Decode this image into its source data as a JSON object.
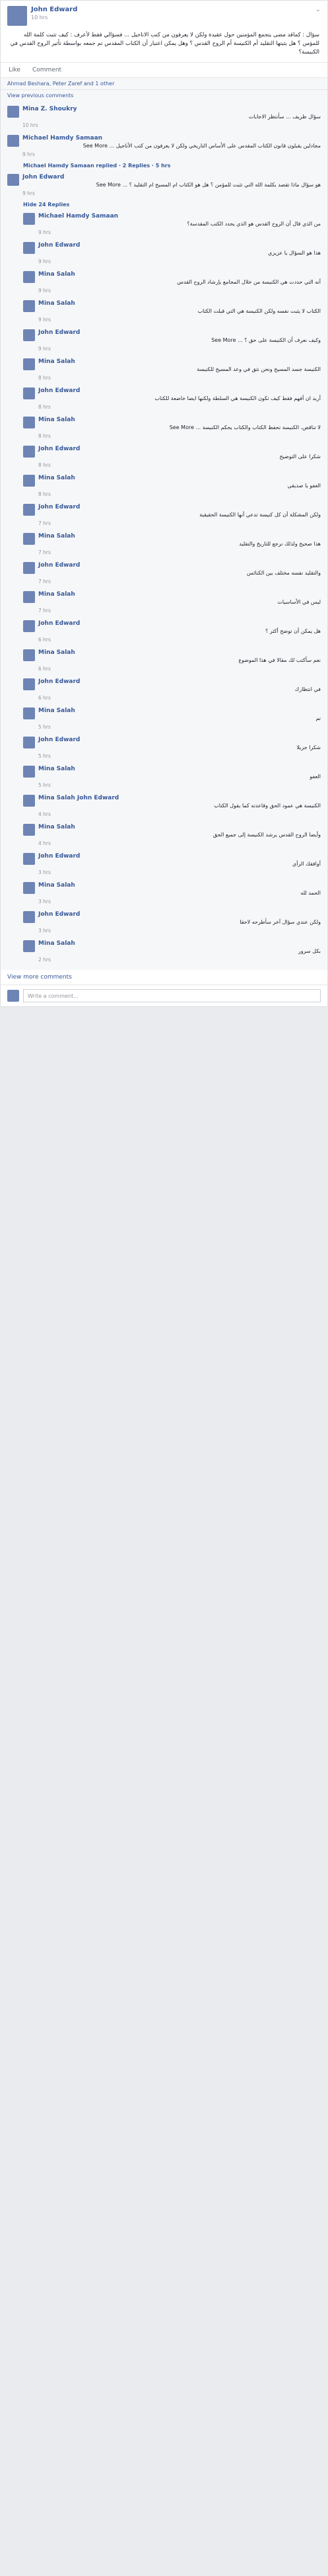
{
  "post": {
    "author": "John Edward",
    "time": "10 hrs",
    "text": "سؤال : كماقد مضى يتجمع المؤمنين حول عقيدة ولكن لا يعرفون من كتب الاناجيل ... فسؤالي فقط لأعرف : كيف تثبت كلمة الله للمؤمن ؟ هل يثبتها التقليد أم الكنيسة أم الروح القدس ؟ وهل يمكن اعتبار أن الكتاب المقدس تم جمعه بواسطة تأثير الروح القدس في الكنيسة؟",
    "actions": {
      "like": "Like",
      "comment": "Comment"
    },
    "likes": "Ahmad Beshara, Peter Zaref and 1 other",
    "view_previous": "View previous comments"
  },
  "comments": [
    {
      "name": "Mina Z. Shoukry",
      "text": "سؤال ظريف ... سأنتظر الاجابات",
      "time": "10 hrs",
      "reply": false
    },
    {
      "name": "Michael Hamdy Samaan",
      "text": "مجادلين يقبلون قانون الكتاب المقدس على الأساس التاريخي ولكن لا يعرفون من كتب الأناجيل ... See More",
      "time": "9 hrs",
      "reply": false
    },
    {
      "name": "Michael Hamdy Samaan replied · 2 Replies · 5 hrs",
      "text": "",
      "time": "",
      "reply": true,
      "toggle": true
    },
    {
      "name": "John Edward",
      "text": "هو سؤال ماذا تقصد بكلمة الله التي تثبت للمؤمن ؟ هل هو الكتاب ام المسيح ام التقليد ؟ ... See More",
      "time": "9 hrs",
      "reply": false
    },
    {
      "name": "Hide 24 Replies",
      "text": "",
      "time": "",
      "reply": true,
      "toggle": true
    },
    {
      "name": "Michael Hamdy Samaan",
      "text": "من الذي قال أن الروح القدس هو الذي يحدد الكتب المقدسة؟",
      "time": "9 hrs",
      "reply": true
    },
    {
      "name": "John Edward",
      "text": "هذا هو السؤال يا عزيزي",
      "time": "9 hrs",
      "reply": true
    },
    {
      "name": "Mina Salah",
      "text": "أنه التي حددت هي الكنيسة من خلال المجامع بإرشاد الروح القدس",
      "time": "9 hrs",
      "reply": true
    },
    {
      "name": "Mina Salah",
      "text": "الكتاب لا يثبت نفسه ولكن الكنيسة هي التي قبلت الكتاب",
      "time": "9 hrs",
      "reply": true
    },
    {
      "name": "John Edward",
      "text": "وكيف نعرف أن الكنيسة على حق ؟ ... See More",
      "time": "9 hrs",
      "reply": true
    },
    {
      "name": "Mina Salah",
      "text": "الكنيسة جسد المسيح ونحن نثق في وعد المسيح للكنيسة",
      "time": "8 hrs",
      "reply": true
    },
    {
      "name": "John Edward",
      "text": "أريد ان أفهم فقط كيف تكون الكنيسة هي السلطة ولكنها ايضا خاضعة للكتاب",
      "time": "8 hrs",
      "reply": true
    },
    {
      "name": "Mina Salah",
      "text": "لا تناقض، الكنيسة تحفظ الكتاب والكتاب يحكم الكنيسة ... See More",
      "time": "8 hrs",
      "reply": true
    },
    {
      "name": "John Edward",
      "text": "شكرا على التوضيح",
      "time": "8 hrs",
      "reply": true
    },
    {
      "name": "Mina Salah",
      "text": "العفو يا صديقي",
      "time": "8 hrs",
      "reply": true
    },
    {
      "name": "John Edward",
      "text": "ولكن المشكلة أن كل كنيسة تدعي أنها الكنيسة الحقيقية",
      "time": "7 hrs",
      "reply": true
    },
    {
      "name": "Mina Salah",
      "text": "هذا صحيح ولذلك نرجع للتاريخ والتقليد",
      "time": "7 hrs",
      "reply": true
    },
    {
      "name": "John Edward",
      "text": "والتقليد نفسه مختلف بين الكنائس",
      "time": "7 hrs",
      "reply": true
    },
    {
      "name": "Mina Salah",
      "text": "ليس في الأساسيات",
      "time": "7 hrs",
      "reply": true
    },
    {
      "name": "John Edward",
      "text": "هل يمكن أن توضح أكثر ؟",
      "time": "6 hrs",
      "reply": true
    },
    {
      "name": "Mina Salah",
      "text": "نعم سأكتب لك مقالا في هذا الموضوع",
      "time": "6 hrs",
      "reply": true
    },
    {
      "name": "John Edward",
      "text": "في انتظارك",
      "time": "6 hrs",
      "reply": true
    },
    {
      "name": "Mina Salah",
      "text": "تم",
      "time": "5 hrs",
      "reply": true
    },
    {
      "name": "John Edward",
      "text": "شكرا جزيلا",
      "time": "5 hrs",
      "reply": true
    },
    {
      "name": "Mina Salah",
      "text": "العفو",
      "time": "5 hrs",
      "reply": true
    },
    {
      "name": "Mina Salah John Edward",
      "text": "الكنيسة هي عمود الحق وقاعدته كما يقول الكتاب",
      "time": "4 hrs",
      "reply": true
    },
    {
      "name": "Mina Salah",
      "text": "وأيضا الروح القدس يرشد الكنيسة إلى جميع الحق",
      "time": "4 hrs",
      "reply": true
    },
    {
      "name": "John Edward",
      "text": "أوافقك الرأي",
      "time": "3 hrs",
      "reply": true
    },
    {
      "name": "Mina Salah",
      "text": "الحمد لله",
      "time": "3 hrs",
      "reply": true
    },
    {
      "name": "John Edward",
      "text": "ولكن عندي سؤال آخر سأطرحه لاحقا",
      "time": "3 hrs",
      "reply": true
    },
    {
      "name": "Mina Salah",
      "text": "بكل سرور",
      "time": "2 hrs",
      "reply": true
    }
  ],
  "write_placeholder": "Write a comment...",
  "view_more": "View more comments"
}
